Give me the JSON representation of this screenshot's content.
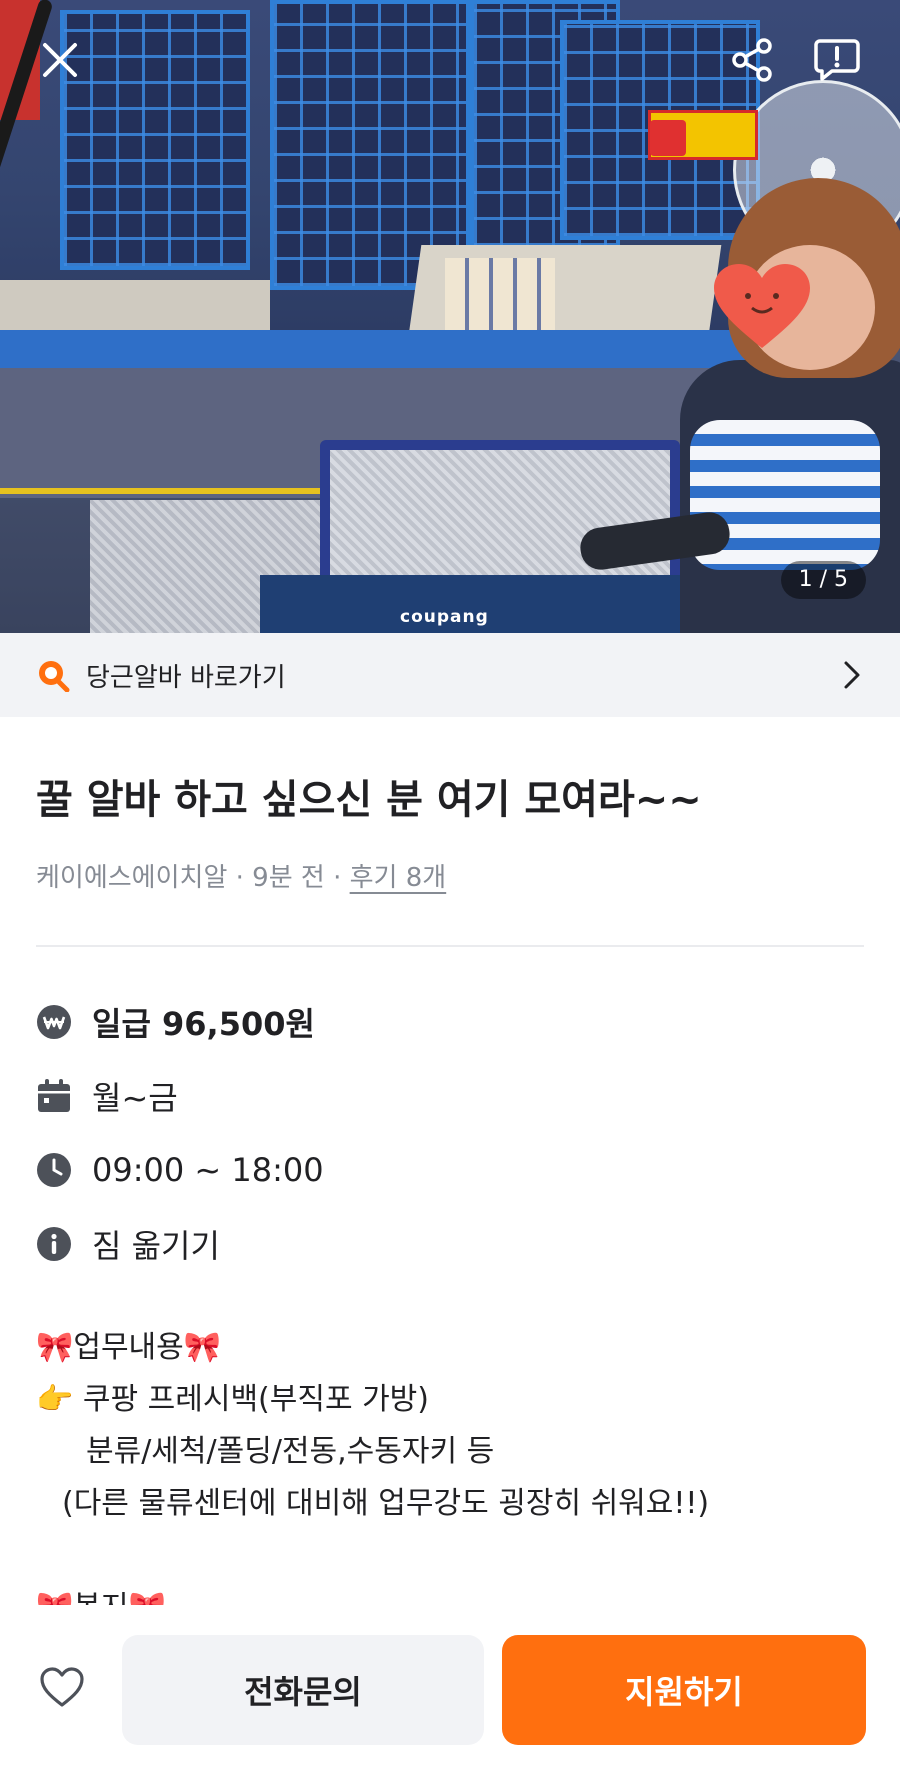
{
  "hero": {
    "image_counter": "1 / 5",
    "bag_brand_text": "coupang",
    "icons": {
      "close": "close-icon",
      "share": "share-icon",
      "report": "report-icon"
    }
  },
  "banner": {
    "icon": "search-icon",
    "label": "당근알바 바로가기",
    "chevron": "chevron-right-icon"
  },
  "post": {
    "title": "꿀 알바 하고 싶으신 분 여기 모여라~~",
    "author": "케이에스에이치알",
    "separator": " · ",
    "time": "9분 전",
    "reviews": "후기 8개"
  },
  "info": {
    "pay": {
      "icon": "won-coin-icon",
      "text": "일급 96,500원"
    },
    "days": {
      "icon": "calendar-icon",
      "text": "월~금"
    },
    "hours": {
      "icon": "clock-icon",
      "text": "09:00 ~ 18:00"
    },
    "task": {
      "icon": "info-icon",
      "text": "짐 옮기기"
    }
  },
  "description": {
    "heading_emoji": "🎀",
    "heading": "업무내용",
    "point_emoji": "👉",
    "line1": "쿠팡 프레시백(부직포 가방)",
    "line2": "분류/세척/폴딩/전동,수동자키 등",
    "line3": "(다른 물류센터에 대비해 업무강도 굉장히 쉬워요!!)",
    "next_heading": "복지"
  },
  "bottom": {
    "call_label": "전화문의",
    "apply_label": "지원하기",
    "heart_icon": "heart-outline-icon"
  },
  "colors": {
    "accent": "#ff6f0f",
    "muted": "#868b94",
    "icon_gray": "#4d5159",
    "banner_bg": "#f2f3f6"
  }
}
